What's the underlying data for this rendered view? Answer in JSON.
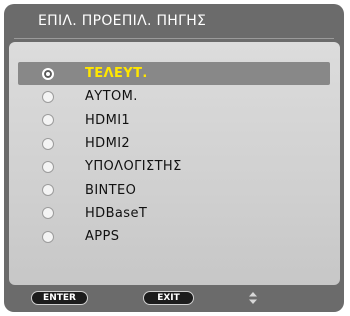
{
  "window": {
    "title": "ΕΠΙΛ. ΠΡΟΕΠΙΛ. ΠΗΓΗΣ"
  },
  "options": [
    {
      "label": "ΤΕΛΕΥΤ.",
      "selected": true
    },
    {
      "label": "ΑΥΤΟΜ.",
      "selected": false
    },
    {
      "label": "HDMI1",
      "selected": false
    },
    {
      "label": "HDMI2",
      "selected": false
    },
    {
      "label": "ΥΠΟΛΟΓΙΣΤΗΣ",
      "selected": false
    },
    {
      "label": "ΒΙΝΤΕΟ",
      "selected": false
    },
    {
      "label": "HDBaseT",
      "selected": false
    },
    {
      "label": "APPS",
      "selected": false
    }
  ],
  "footer": {
    "enter_label": "ENTER",
    "exit_label": "EXIT",
    "updown_icon": "up-down-arrows-icon"
  },
  "colors": {
    "window_bg": "#6b6b6b",
    "panel_bg": "#d4d4d4",
    "selected_bg": "#888888",
    "selected_text": "#ffe600"
  }
}
